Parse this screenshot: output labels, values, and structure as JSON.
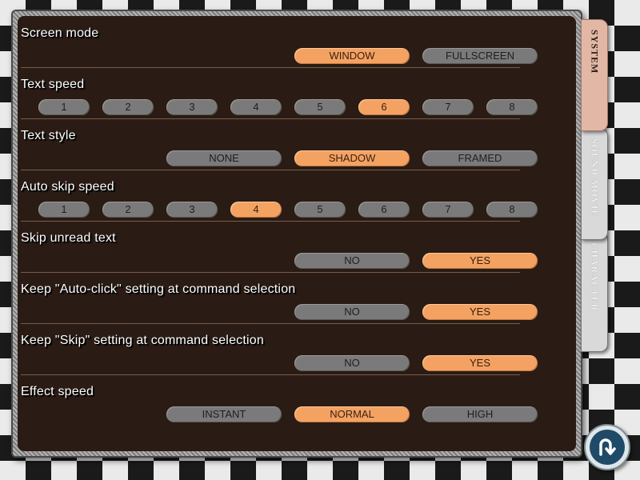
{
  "tabs": {
    "system": "SYSTEM",
    "sound_movie": "SOUND/MOVIE",
    "character": "CHARACTER"
  },
  "settings": [
    {
      "label": "Screen mode",
      "options": [
        "WINDOW",
        "FULLSCREEN"
      ],
      "selected": "WINDOW"
    },
    {
      "label": "Text speed",
      "options": [
        "1",
        "2",
        "3",
        "4",
        "5",
        "6",
        "7",
        "8"
      ],
      "selected": "6"
    },
    {
      "label": "Text style",
      "options": [
        "NONE",
        "SHADOW",
        "FRAMED"
      ],
      "selected": "SHADOW"
    },
    {
      "label": "Auto skip speed",
      "options": [
        "1",
        "2",
        "3",
        "4",
        "5",
        "6",
        "7",
        "8"
      ],
      "selected": "4"
    },
    {
      "label": "Skip unread text",
      "options": [
        "NO",
        "YES"
      ],
      "selected": "YES"
    },
    {
      "label": "Keep \"Auto-click\" setting at command selection",
      "options": [
        "NO",
        "YES"
      ],
      "selected": "YES"
    },
    {
      "label": "Keep \"Skip\" setting at command selection",
      "options": [
        "NO",
        "YES"
      ],
      "selected": "YES"
    },
    {
      "label": "Effect speed",
      "options": [
        "INSTANT",
        "NORMAL",
        "HIGH"
      ],
      "selected": "NORMAL"
    }
  ],
  "icons": {
    "back": "return-arrow-icon"
  },
  "colors": {
    "selected": "#f4a262",
    "unselected": "#7a7a7a",
    "panel": "#2a1c14"
  }
}
